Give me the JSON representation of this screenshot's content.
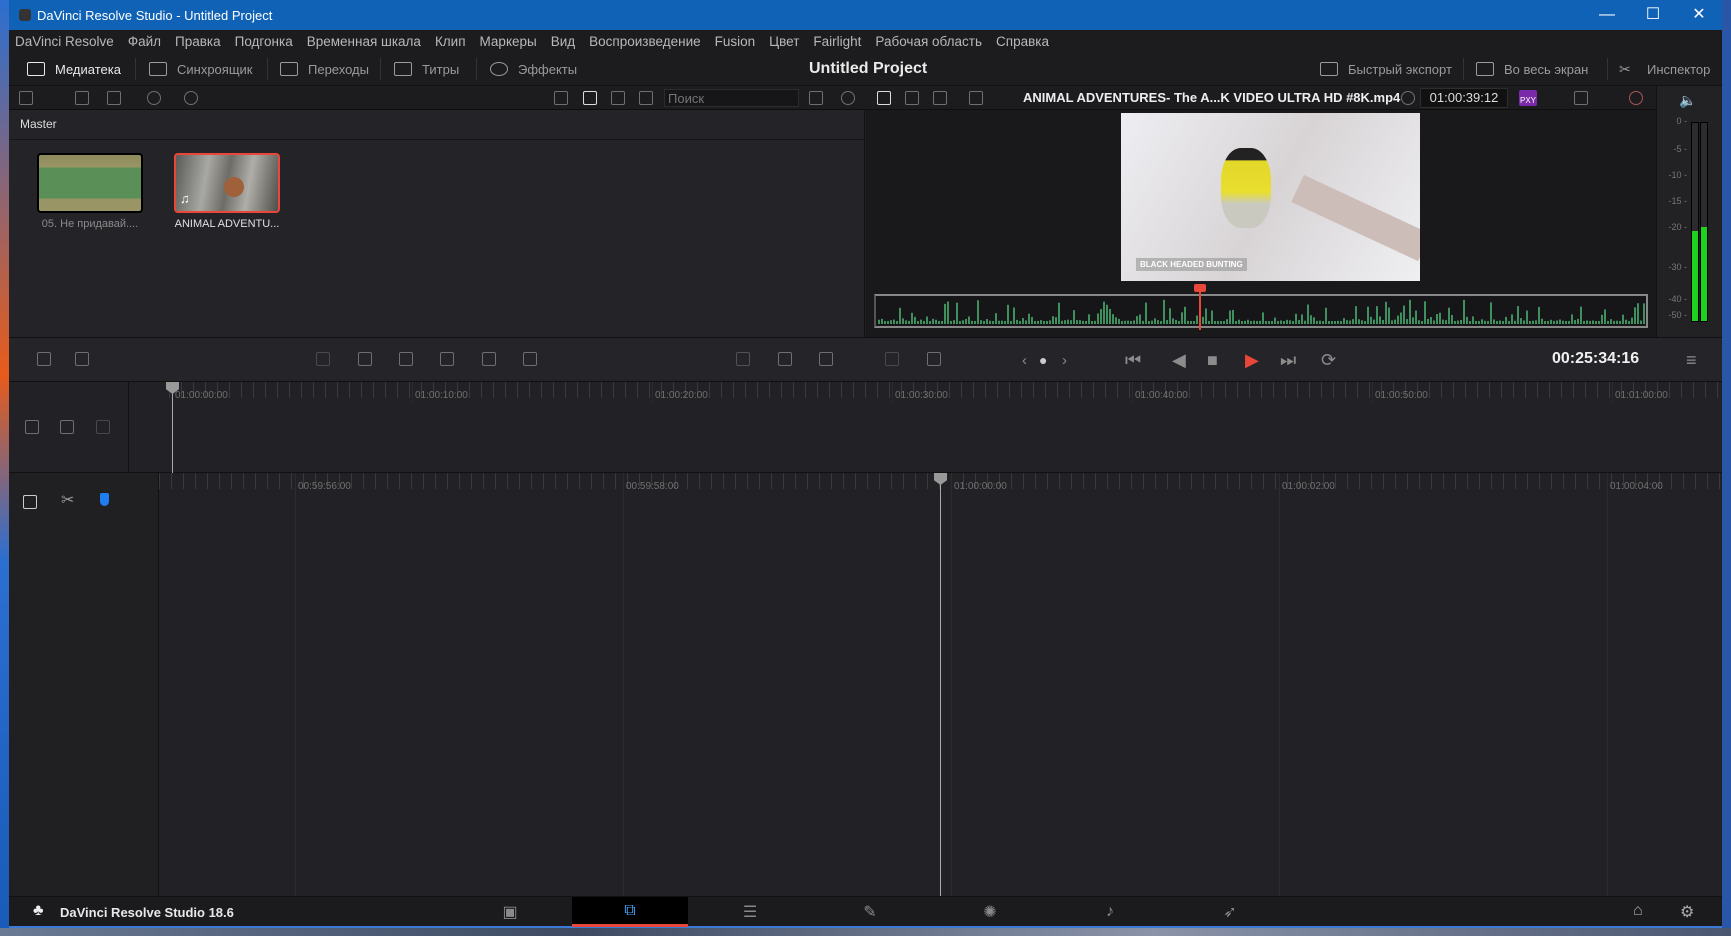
{
  "window": {
    "title": "DaVinci Resolve Studio - Untitled Project",
    "minimize": "—",
    "maximize": "☐",
    "close": "✕"
  },
  "menu": [
    "DaVinci Resolve",
    "Файл",
    "Правка",
    "Подгонка",
    "Временная шкала",
    "Клип",
    "Маркеры",
    "Вид",
    "Воспроизведение",
    "Fusion",
    "Цвет",
    "Fairlight",
    "Рабочая область",
    "Справка"
  ],
  "toolbar": {
    "media": "Медиатека",
    "sync": "Синхроящик",
    "transitions": "Переходы",
    "titles": "Титры",
    "effects": "Эффекты",
    "project": "Untitled Project",
    "quick_export": "Быстрый экспорт",
    "fullscreen": "Во весь экран",
    "inspector": "Инспектор"
  },
  "search": {
    "placeholder": "Поиск"
  },
  "viewer": {
    "clip_name": "ANIMAL ADVENTURES- The A...K VIDEO ULTRA HD #8K.mp4",
    "timecode": "01:00:39:12",
    "proxy_badge": "PXY",
    "overlay_text": "BLACK HEADED BUNTING"
  },
  "media_pool": {
    "bin": "Master",
    "clips": [
      {
        "name": "05. Не придавай...."
      },
      {
        "name": "ANIMAL ADVENTU...",
        "selected": true
      }
    ]
  },
  "meter": {
    "scale": [
      "0",
      "-5",
      "-10",
      "-15",
      "-20",
      "-30",
      "-40",
      "-50"
    ],
    "levels_db": [
      -21,
      -20
    ],
    "color": "#1ed31e"
  },
  "transport": {
    "timecode": "00:25:34:16",
    "play_color": "#e8473a"
  },
  "timeline_upper": {
    "ticks": [
      "01:00:00:00",
      "01:00:10:00",
      "01:00:20:00",
      "01:00:30:00",
      "01:00:40:00",
      "01:00:50:00",
      "01:01:00:00"
    ]
  },
  "timeline_lower": {
    "ticks": [
      "00:59:56:00",
      "00:59:58:00",
      "01:00:00:00",
      "01:00:02:00",
      "01:00:04:00"
    ]
  },
  "bottom": {
    "app": "DaVinci Resolve Studio 18.6",
    "pages": [
      "media-icon",
      "cut-icon",
      "edit-icon",
      "fusion-icon",
      "color-icon",
      "fairlight-icon",
      "deliver-icon"
    ],
    "active_page": 1,
    "accent": "#e8473a"
  }
}
